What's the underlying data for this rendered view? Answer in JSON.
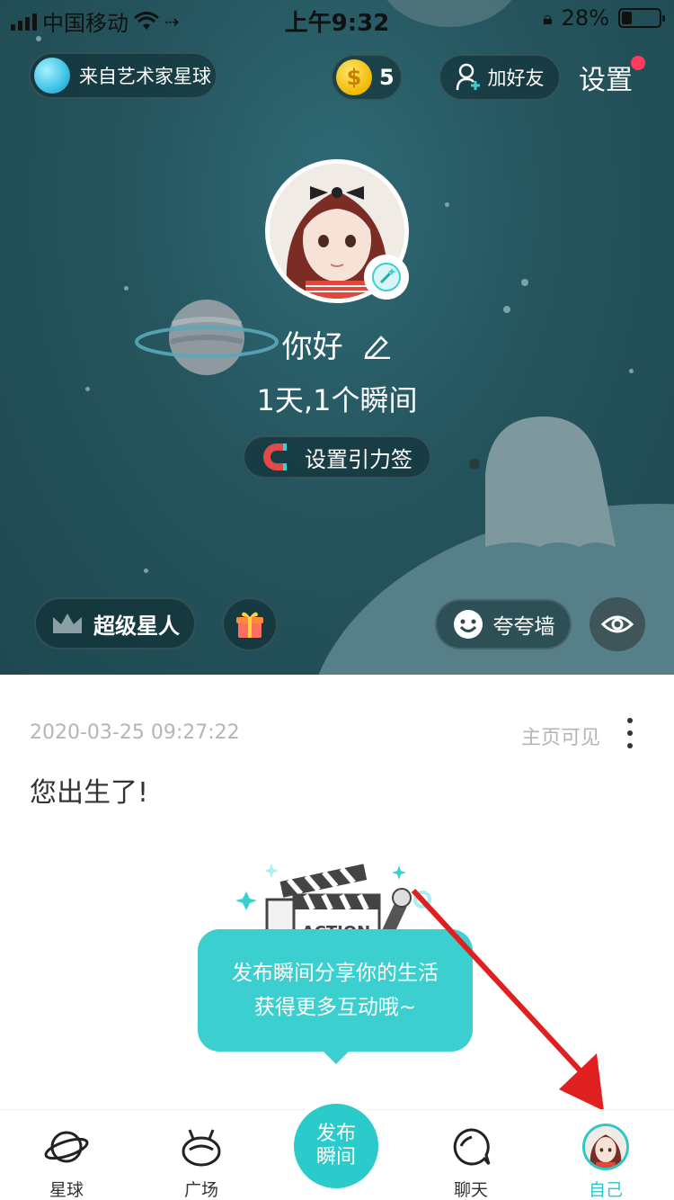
{
  "status_bar": {
    "carrier": "中国移动",
    "time": "上午9:32",
    "battery": "28%",
    "battery_level": 0.28
  },
  "header": {
    "origin_label": "来自艺术家星球",
    "coins": "5",
    "add_friend_label": "加好友",
    "settings_label": "设置"
  },
  "profile": {
    "name": "你好",
    "stats": "1天,1个瞬间",
    "gravity_tag_label": "设置引力签"
  },
  "actions": {
    "superstar_label": "超级星人",
    "praise_wall_label": "夸夸墙"
  },
  "post": {
    "date": "2020-03-25 09:27:22",
    "visibility": "主页可见",
    "text": "您出生了!"
  },
  "promo": {
    "clapper_text": "ACTION",
    "line1": "发布瞬间分享你的生活",
    "line2": "获得更多互动哦~"
  },
  "tabbar": {
    "tabs": [
      {
        "label": "星球",
        "icon": "planet-icon"
      },
      {
        "label": "广场",
        "icon": "square-icon"
      },
      {
        "label": "聊天",
        "icon": "chat-icon"
      },
      {
        "label": "自己",
        "icon": "avatar"
      }
    ],
    "publish_line1": "发布",
    "publish_line2": "瞬间",
    "active_tab": "自己"
  },
  "colors": {
    "accent": "#2cc8c8",
    "hero_bg": "#25545d",
    "notify": "#ff3b5c",
    "arrow": "#e02020"
  }
}
